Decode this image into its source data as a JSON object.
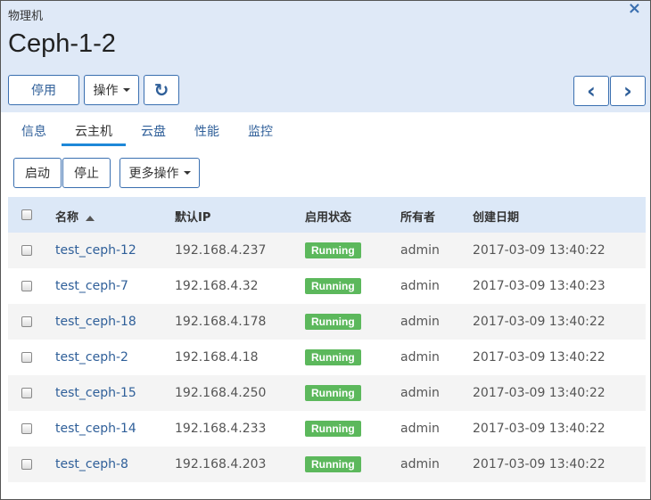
{
  "header": {
    "breadcrumb": "物理机",
    "title": "Ceph-1-2",
    "close_icon": "×"
  },
  "toolbar": {
    "stop_label": "停用",
    "ops_label": "操作",
    "refresh_icon": "↻",
    "prev_icon": "‹",
    "next_icon": "›"
  },
  "tabs": [
    {
      "label": "信息"
    },
    {
      "label": "云主机"
    },
    {
      "label": "云盘"
    },
    {
      "label": "性能"
    },
    {
      "label": "监控"
    }
  ],
  "actions": {
    "start_label": "启动",
    "stop_label": "停止",
    "more_label": "更多操作"
  },
  "table": {
    "columns": [
      "名称",
      "默认IP",
      "启用状态",
      "所有者",
      "创建日期"
    ],
    "rows": [
      {
        "name": "test_ceph-12",
        "ip": "192.168.4.237",
        "status": "Running",
        "owner": "admin",
        "created": "2017-03-09 13:40:22"
      },
      {
        "name": "test_ceph-7",
        "ip": "192.168.4.32",
        "status": "Running",
        "owner": "admin",
        "created": "2017-03-09 13:40:23"
      },
      {
        "name": "test_ceph-18",
        "ip": "192.168.4.178",
        "status": "Running",
        "owner": "admin",
        "created": "2017-03-09 13:40:22"
      },
      {
        "name": "test_ceph-2",
        "ip": "192.168.4.18",
        "status": "Running",
        "owner": "admin",
        "created": "2017-03-09 13:40:22"
      },
      {
        "name": "test_ceph-15",
        "ip": "192.168.4.250",
        "status": "Running",
        "owner": "admin",
        "created": "2017-03-09 13:40:22"
      },
      {
        "name": "test_ceph-14",
        "ip": "192.168.4.233",
        "status": "Running",
        "owner": "admin",
        "created": "2017-03-09 13:40:22"
      },
      {
        "name": "test_ceph-8",
        "ip": "192.168.4.203",
        "status": "Running",
        "owner": "admin",
        "created": "2017-03-09 13:40:22"
      }
    ]
  },
  "colors": {
    "header_bg": "#dfe9f7",
    "accent": "#2f5f99",
    "running_badge": "#5cb85c",
    "tab_underline": "#1e88d8"
  }
}
